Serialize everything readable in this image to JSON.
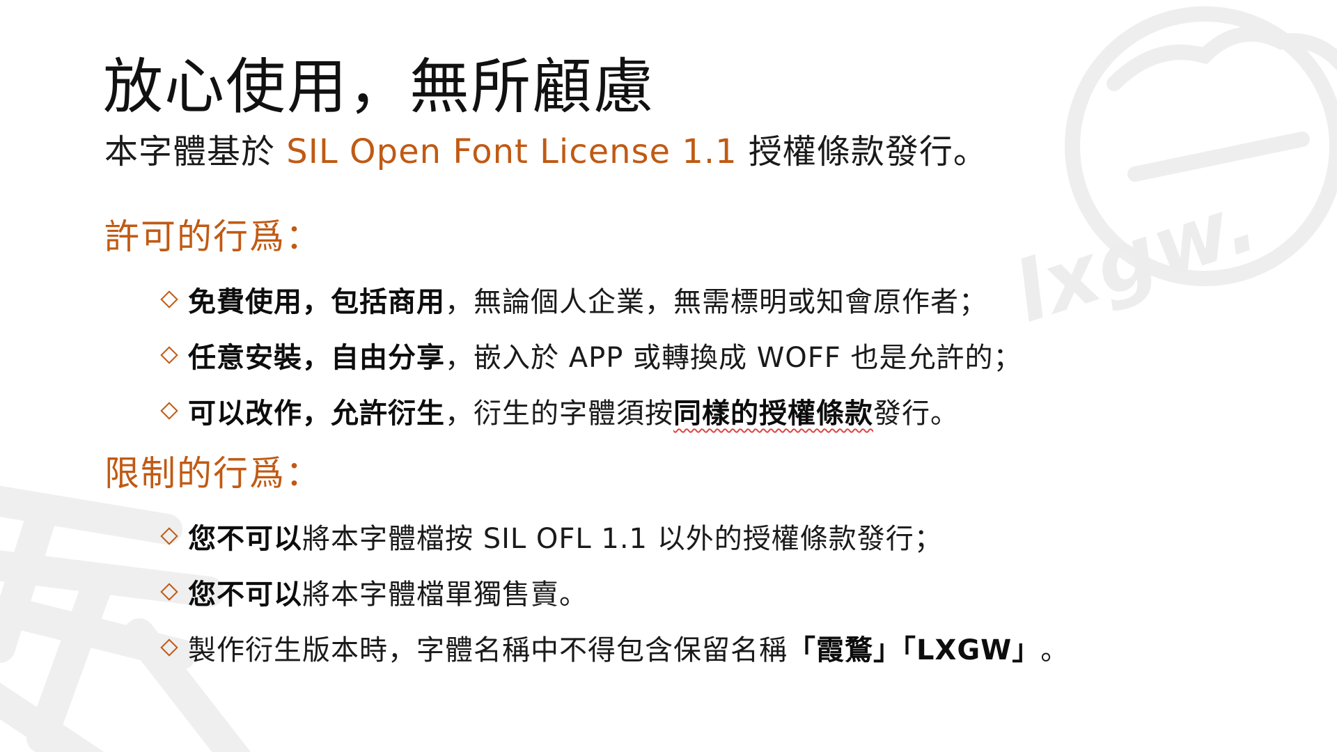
{
  "title": "放心使用，無所顧慮",
  "subtitle": {
    "before": "本字體基於 ",
    "license": "SIL Open Font License 1.1",
    "after": " 授權條款發行。"
  },
  "allowed": {
    "heading": "許可的行爲：",
    "items": [
      {
        "bold": "免費使用，包括商用",
        "text": "，無論個人企業，無需標明或知會原作者；"
      },
      {
        "bold": "任意安裝，自由分享",
        "text": "，嵌入於 APP 或轉換成 WOFF 也是允許的；"
      },
      {
        "bold": "可以改作，允許衍生",
        "text": "，衍生的字體須按",
        "bold2": "同樣的授權條款",
        "text2": "發行。"
      }
    ]
  },
  "restricted": {
    "heading": "限制的行爲：",
    "items": [
      {
        "bold": "您不可以",
        "text": "將本字體檔按 SIL OFL 1.1 以外的授權條款發行；"
      },
      {
        "bold": "您不可以",
        "text": "將本字體檔單獨售賣。"
      },
      {
        "text": "製作衍生版本時，字體名稱中不得包含保留名稱",
        "bold": "「霞鶩」「LXGW」",
        "text2": "。"
      }
    ]
  },
  "watermark": {
    "logo_text": "lxgw.",
    "glyph_icon": "brush-glyph-watermark"
  },
  "colors": {
    "accent": "#c05a14",
    "text": "#1a1a1a",
    "watermark": "#ededed"
  }
}
